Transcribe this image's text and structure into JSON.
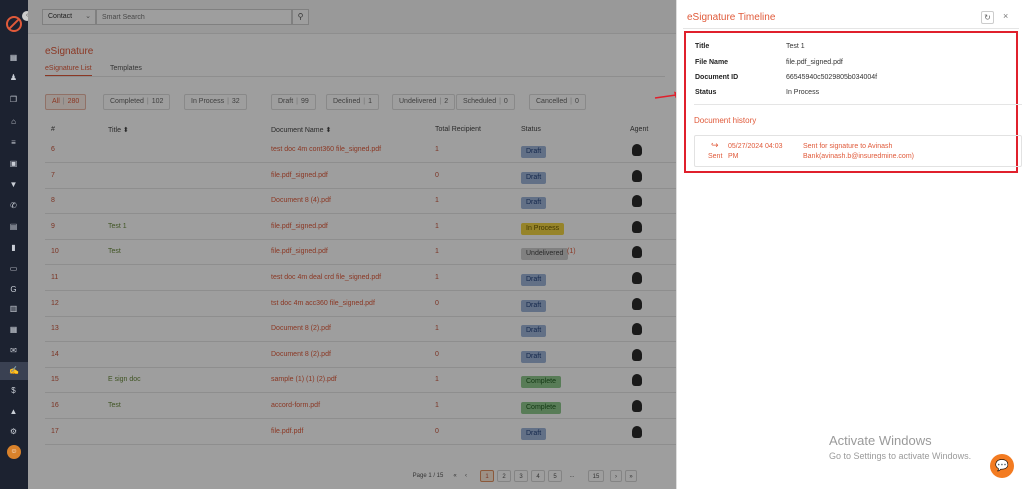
{
  "sidebar": {
    "toggle": "‹",
    "avatar": "☺",
    "icons": [
      "grid-icon",
      "users-icon",
      "stack-icon",
      "bank-icon",
      "list-icon",
      "contact-card-icon",
      "filter-icon",
      "megaphone-icon",
      "document-icon",
      "chart-icon",
      "folder-icon",
      "google-icon",
      "file-icon",
      "calendar-icon",
      "mail-icon",
      "signature-icon",
      "dollar-icon",
      "analytics-icon",
      "settings-icon"
    ],
    "glyphs": [
      "▦",
      "♟",
      "❐",
      "⌂",
      "≡",
      "▣",
      "▼",
      "✆",
      "▤",
      "▮",
      "▭",
      "G",
      "▥",
      "▦",
      "✉",
      "✍",
      "$",
      "▲",
      "⚙"
    ]
  },
  "topbar": {
    "contact_select": "Contact",
    "chevron": "⌄",
    "search_placeholder": "Smart Search",
    "search_glyph": "⚲"
  },
  "page": {
    "title": "eSignature",
    "tabs": [
      "eSignature List",
      "Templates"
    ]
  },
  "filters": [
    {
      "label": "All",
      "count": "280"
    },
    {
      "label": "Completed",
      "count": "102"
    },
    {
      "label": "In Process",
      "count": "32"
    },
    {
      "label": "Draft",
      "count": "99"
    },
    {
      "label": "Declined",
      "count": "1"
    },
    {
      "label": "Undelivered",
      "count": "2"
    },
    {
      "label": "Scheduled",
      "count": "0"
    },
    {
      "label": "Cancelled",
      "count": "0"
    }
  ],
  "table": {
    "headers": [
      "#",
      "Title ⬍",
      "Document Name ⬍",
      "Total Recipient",
      "Status",
      "Agent"
    ],
    "rows": [
      {
        "num": "6",
        "title": "",
        "doc": "test doc 4m cont360 file_signed.pdf",
        "rec": "1",
        "status": "Draft",
        "cls": "draft",
        "cnt": ""
      },
      {
        "num": "7",
        "title": "",
        "doc": "file.pdf_signed.pdf",
        "rec": "0",
        "status": "Draft",
        "cls": "draft",
        "cnt": ""
      },
      {
        "num": "8",
        "title": "",
        "doc": "Document 8 (4).pdf",
        "rec": "1",
        "status": "Draft",
        "cls": "draft",
        "cnt": ""
      },
      {
        "num": "9",
        "title": "Test 1",
        "doc": "file.pdf_signed.pdf",
        "rec": "1",
        "status": "In Process",
        "cls": "inproc",
        "cnt": ""
      },
      {
        "num": "10",
        "title": "Test",
        "doc": "file.pdf_signed.pdf",
        "rec": "1",
        "status": "Undelivered",
        "cls": "undel",
        "cnt": "(1)"
      },
      {
        "num": "11",
        "title": "",
        "doc": "test doc 4m deal crd file_signed.pdf",
        "rec": "1",
        "status": "Draft",
        "cls": "draft",
        "cnt": ""
      },
      {
        "num": "12",
        "title": "",
        "doc": "tst doc 4m acc360 file_signed.pdf",
        "rec": "0",
        "status": "Draft",
        "cls": "draft",
        "cnt": ""
      },
      {
        "num": "13",
        "title": "",
        "doc": "Document 8 (2).pdf",
        "rec": "1",
        "status": "Draft",
        "cls": "draft",
        "cnt": ""
      },
      {
        "num": "14",
        "title": "",
        "doc": "Document 8 (2).pdf",
        "rec": "0",
        "status": "Draft",
        "cls": "draft",
        "cnt": ""
      },
      {
        "num": "15",
        "title": "E sign doc",
        "doc": "sample (1) (1) (2).pdf",
        "rec": "1",
        "status": "Complete",
        "cls": "comp",
        "cnt": ""
      },
      {
        "num": "16",
        "title": "Test",
        "doc": "accord-form.pdf",
        "rec": "1",
        "status": "Complete",
        "cls": "comp",
        "cnt": ""
      },
      {
        "num": "17",
        "title": "",
        "doc": "file.pdf.pdf",
        "rec": "0",
        "status": "Draft",
        "cls": "draft",
        "cnt": ""
      }
    ]
  },
  "pagination": {
    "label": "Page 1 / 15",
    "first": "«",
    "prev": "‹",
    "pages": [
      "1",
      "2",
      "3",
      "4",
      "5"
    ],
    "ellipsis": "...",
    "last_page": "15",
    "next": "›",
    "last": "»"
  },
  "timeline": {
    "title": "eSignature Timeline",
    "refresh": "↻",
    "close": "×",
    "fields": [
      {
        "label": "Title",
        "value": "Test 1"
      },
      {
        "label": "File Name",
        "value": "file.pdf_signed.pdf"
      },
      {
        "label": "Document ID",
        "value": "66545940c5029805b034004f"
      },
      {
        "label": "Status",
        "value": "In Process"
      }
    ],
    "history_title": "Document history",
    "history": [
      {
        "icon": "↪",
        "action": "Sent",
        "date": "05/27/2024 04:03 PM",
        "desc": "Sent for signature to Avinash Bank(avinash.b@insuredmine.com)"
      }
    ]
  },
  "os": {
    "activate_title": "Activate Windows",
    "activate_sub": "Go to Settings to activate Windows.",
    "chat_glyph": "💬"
  },
  "colors": {
    "accent": "#e05a3a",
    "highlight": "#e0202c",
    "chat": "#f37b21"
  }
}
